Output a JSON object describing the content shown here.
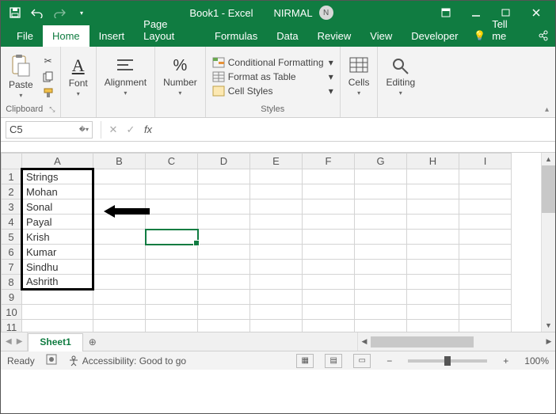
{
  "titlebar": {
    "title": "Book1 - Excel",
    "user_name": "NIRMAL",
    "user_initial": "N"
  },
  "tabs": {
    "file": "File",
    "home": "Home",
    "insert": "Insert",
    "page_layout": "Page Layout",
    "formulas": "Formulas",
    "data": "Data",
    "review": "Review",
    "view": "View",
    "developer": "Developer",
    "tell_me": "Tell me"
  },
  "ribbon": {
    "paste": "Paste",
    "clipboard": "Clipboard",
    "font": "Font",
    "alignment": "Alignment",
    "number": "Number",
    "conditional_formatting": "Conditional Formatting",
    "format_as_table": "Format as Table",
    "cell_styles": "Cell Styles",
    "styles": "Styles",
    "cells": "Cells",
    "editing": "Editing"
  },
  "namebox": {
    "value": "C5"
  },
  "formula_bar": {
    "value": ""
  },
  "columns": [
    "A",
    "B",
    "C",
    "D",
    "E",
    "F",
    "G",
    "H",
    "I"
  ],
  "rows": [
    "1",
    "2",
    "3",
    "4",
    "5",
    "6",
    "7",
    "8",
    "9",
    "10",
    "11"
  ],
  "cells": {
    "A1": "Strings",
    "A2": "Mohan",
    "A3": "Sonal",
    "A4": "Payal",
    "A5": "Krish",
    "A6": "Kumar",
    "A7": "Sindhu",
    "A8": "Ashrith"
  },
  "selected_cell": "C5",
  "sheet_tabs": {
    "sheet1": "Sheet1"
  },
  "status": {
    "ready": "Ready",
    "accessibility": "Accessibility: Good to go",
    "zoom": "100%"
  }
}
